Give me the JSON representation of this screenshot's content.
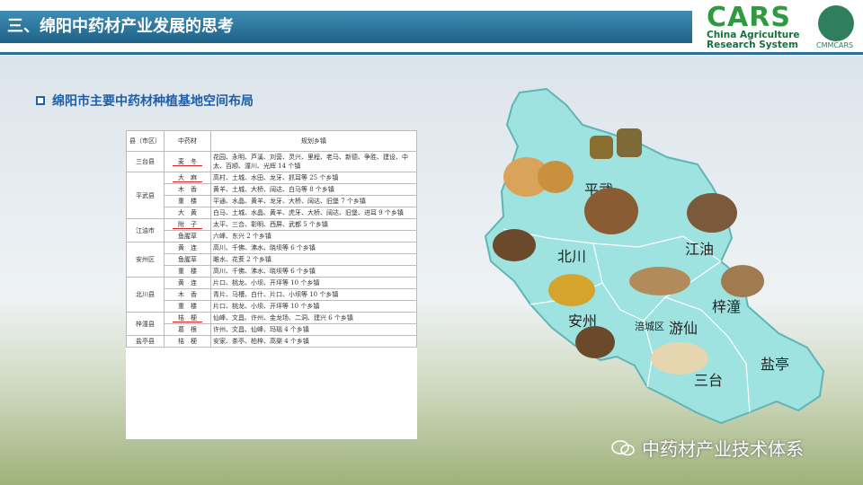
{
  "header": {
    "title": "三、绵阳中药材产业发展的思考",
    "logo_mark": "CARS",
    "logo_line1": "China Agriculture",
    "logo_line2": "Research System",
    "logo_right": "CMMCARS"
  },
  "section": {
    "title": "绵阳市主要中药材种植基地空间布局"
  },
  "table": {
    "headers": [
      "县（市区）",
      "中药材",
      "规划乡镇"
    ],
    "groups": [
      {
        "county": "三台县",
        "rows": [
          {
            "herb": "麦　冬",
            "towns": "花园、永明、芦溪、刘营、灵兴、里程、老马、新德、争胜、建设、中太、百顺、潼川、光辉 14 个镇",
            "underline": true
          }
        ]
      },
      {
        "county": "平武县",
        "rows": [
          {
            "herb": "大　麻",
            "towns": "高村、土城、水田、龙牙、抓耳等 25 个乡镇",
            "underline": true
          },
          {
            "herb": "木　香",
            "towns": "黄羊、土城、大桥、阔达、白马等 8 个乡镇"
          },
          {
            "herb": "重　楼",
            "towns": "平通、水晶、黄羊、龙牙、大桥、阔达、旧堡 7 个乡镇"
          },
          {
            "herb": "大　黄",
            "towns": "白马、土城、水晶、黄羊、虎牙、大桥、阔达、旧堡、进耳 9 个乡镇"
          }
        ]
      },
      {
        "county": "江油市",
        "rows": [
          {
            "herb": "附　子",
            "towns": "太平、三合、彰明、西屏、武都 5 个乡镇",
            "underline": true
          },
          {
            "herb": "鱼腥草",
            "towns": "六峰、东兴 2 个乡镇"
          }
        ]
      },
      {
        "county": "安州区",
        "rows": [
          {
            "herb": "黄　连",
            "towns": "高川、千佛、沸水、晓坝等 6 个乡镇"
          },
          {
            "herb": "鱼腥草",
            "towns": "雎水、花荄 2 个乡镇"
          },
          {
            "herb": "重　楼",
            "towns": "高川、千佛、沸水、晓坝等 6 个乡镇"
          }
        ]
      },
      {
        "county": "北川县",
        "rows": [
          {
            "herb": "黄　连",
            "towns": "片口、桃龙、小坝、开坪等 10 个乡镇"
          },
          {
            "herb": "木　香",
            "towns": "青片、马槽、白什、片口、小坝等 10 个乡镇"
          },
          {
            "herb": "重　楼",
            "towns": "片口、桃龙、小坝、开坪等 10 个乡镇"
          }
        ]
      },
      {
        "county": "梓潼县",
        "rows": [
          {
            "herb": "桔　梗",
            "towns": "仙峰、文昌、许州、金龙场、二洞、建兴 6 个乡镇",
            "underline": true
          },
          {
            "herb": "葛　根",
            "towns": "许州、文昌、仙峰、玛瑙 4 个乡镇"
          }
        ]
      },
      {
        "county": "盐亭县",
        "rows": [
          {
            "herb": "桔　梗",
            "towns": "安家、茶亭、柏梓、高渠 4 个乡镇"
          }
        ]
      }
    ]
  },
  "map": {
    "fill": "#9fe3e0",
    "labels": [
      "平武",
      "江油",
      "北川",
      "梓潼",
      "安州",
      "涪城区",
      "游仙",
      "三台",
      "盐亭"
    ]
  },
  "watermark": {
    "text": "中药材产业技术体系"
  }
}
